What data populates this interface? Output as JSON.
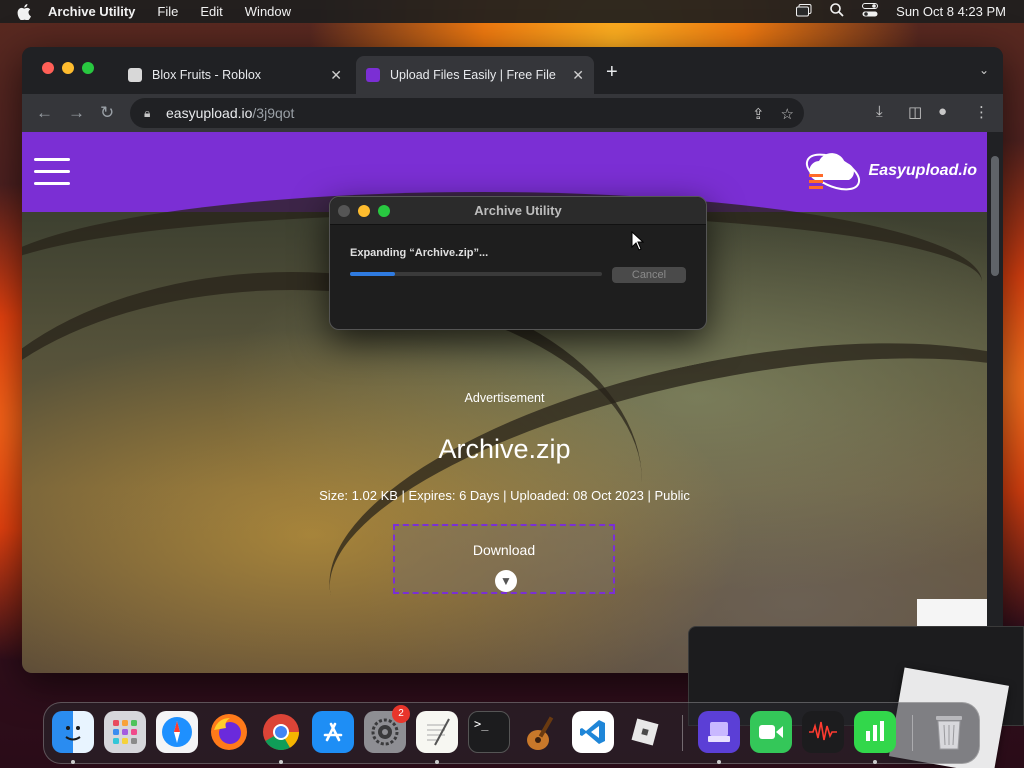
{
  "menubar": {
    "app_name": "Archive Utility",
    "menus": [
      "File",
      "Edit",
      "Window"
    ],
    "clock": "Sun Oct 8  4:23 PM"
  },
  "browser": {
    "tabs": [
      {
        "title": "Blox Fruits - Roblox",
        "active": false
      },
      {
        "title": "Upload Files Easily | Free File",
        "active": true
      }
    ],
    "url": {
      "host": "easyupload.io",
      "path": "/3j9qot"
    }
  },
  "site": {
    "logo_text": "Easyupload.io",
    "ad_label": "Advertisement",
    "file_name": "Archive.zip",
    "file_meta": "Size: 1.02 KB | Expires: 6 Days | Uploaded: 08 Oct 2023 | Public",
    "download_label": "Download"
  },
  "dialog": {
    "title": "Archive Utility",
    "status": "Expanding “Archive.zip”...",
    "progress_percent": 18,
    "cancel_label": "Cancel"
  },
  "dock": {
    "settings_badge": "2"
  },
  "colors": {
    "accent_purple": "#7b2fd4",
    "progress_blue": "#2f7be0"
  }
}
